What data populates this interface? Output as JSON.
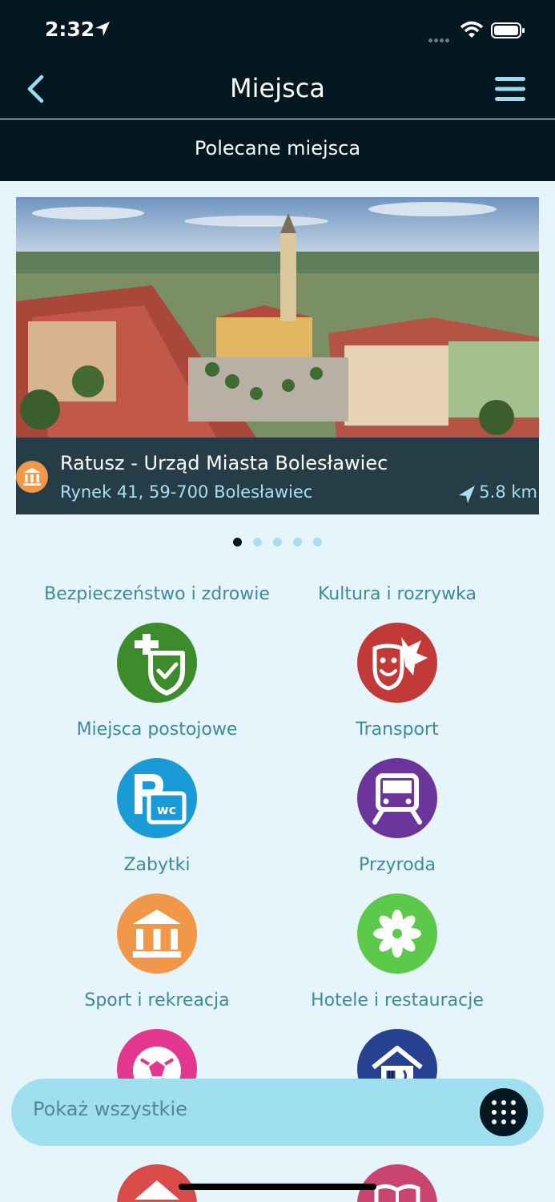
{
  "status_bar": {
    "time": "2:32"
  },
  "nav": {
    "title": "Miejsca"
  },
  "subheader": {
    "title": "Polecane miejsca"
  },
  "featured": {
    "name": "Ratusz - Urząd Miasta Bolesławiec",
    "address": "Rynek 41, 59-700 Bolesławiec",
    "distance": "5.8 km",
    "category_icon": "museum-icon",
    "pages": 5,
    "active_page": 1
  },
  "categories": [
    {
      "label": "Bezpieczeństwo i zdrowie",
      "icon": "health-shield-icon",
      "color": "#3d8c2c"
    },
    {
      "label": "Kultura i rozrywka",
      "icon": "theater-mask-icon",
      "color": "#c13a37"
    },
    {
      "label": "Miejsca postojowe",
      "icon": "parking-wc-icon",
      "color": "#1a9bd7"
    },
    {
      "label": "Transport",
      "icon": "train-icon",
      "color": "#6b359b"
    },
    {
      "label": "Zabytki",
      "icon": "museum-icon",
      "color": "#f0974a"
    },
    {
      "label": "Przyroda",
      "icon": "flower-icon",
      "color": "#5cc94a"
    },
    {
      "label": "Sport i rekreacja",
      "icon": "soccer-ball-icon",
      "color": "#e3378f"
    },
    {
      "label": "Hotele i restauracje",
      "icon": "hotel-restaurant-icon",
      "color": "#25418f"
    },
    {
      "label": "",
      "icon": "home-icon",
      "color": "#d94a48"
    },
    {
      "label": "",
      "icon": "book-icon",
      "color": "#c9456f"
    }
  ],
  "bottom_bar": {
    "label": "Pokaż wszystkie",
    "icon": "grid-icon"
  },
  "colors": {
    "dark": "#041821",
    "accent": "#a8dff0",
    "background": "#e6f5fb"
  }
}
